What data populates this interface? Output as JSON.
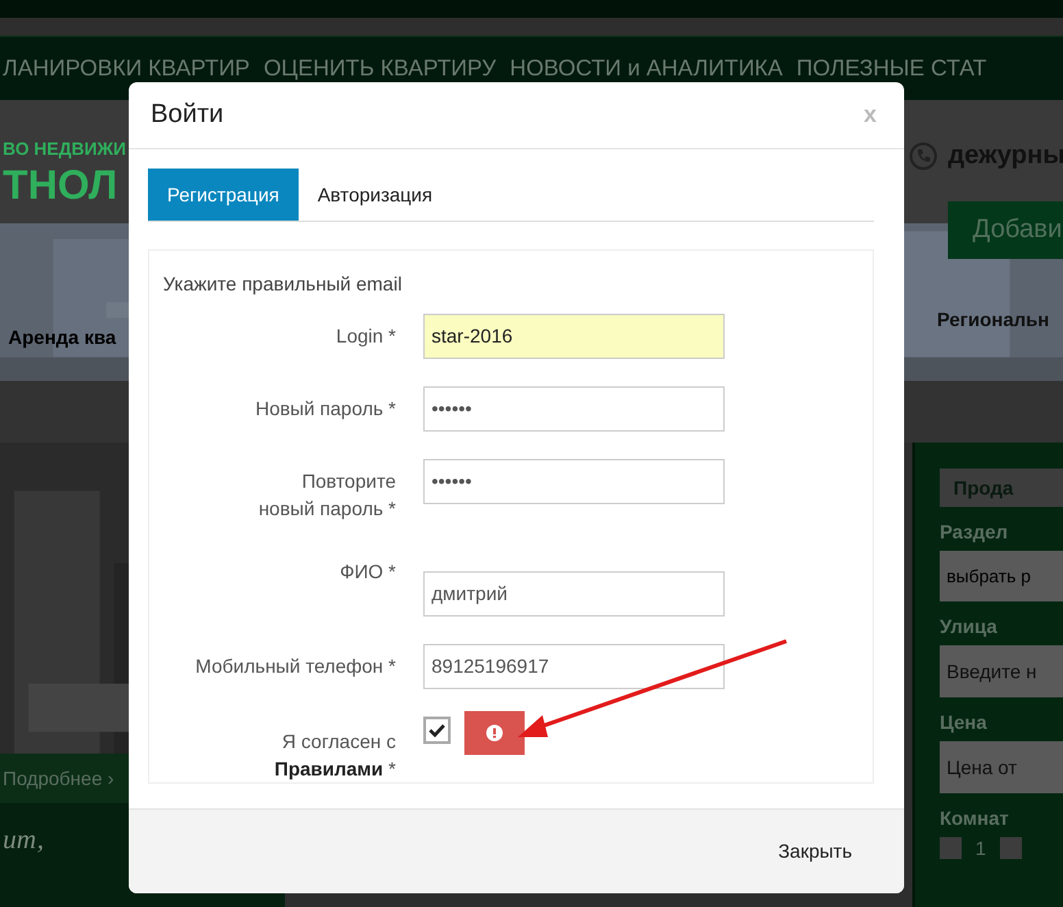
{
  "background": {
    "nav": [
      "ЛАНИРОВКИ КВАРТИР",
      "ОЦЕНИТЬ КВАРТИРУ",
      "НОВОСТИ и АНАЛИТИКА",
      "ПОЛЕЗНЫЕ СТАТ"
    ],
    "header": {
      "tagline": "ВО НЕДВИЖИ",
      "logo": "ТНОЛ",
      "phone": "дежурны",
      "add_button": "Добави",
      "left_caption": "Аренда ква",
      "right_caption": "Региональн"
    },
    "slide": {
      "link": "Подробнее",
      "link_arrow": "›",
      "quote": "ит,"
    },
    "filter": {
      "tab": "Прода",
      "fields": [
        {
          "kind": "select",
          "label": "Раздел",
          "value": "выбрать р"
        },
        {
          "kind": "input",
          "label": "Улица",
          "placeholder": "Введите н"
        },
        {
          "kind": "input",
          "label": "Цена",
          "placeholder": "Цена от"
        },
        {
          "kind": "checks",
          "label": "Комнат",
          "options": [
            {
              "label": "1",
              "checked": false
            },
            {
              "checked": false
            }
          ]
        }
      ]
    }
  },
  "dialog": {
    "title": "Войти",
    "close": "x",
    "tabs": [
      {
        "label": "Регистрация",
        "selected": true
      },
      {
        "label": "Авторизация",
        "selected": false
      }
    ],
    "notice": "Укажите правильный email",
    "fields": [
      {
        "label": "Login *",
        "value": "star-2016",
        "autofilled": true
      },
      {
        "label": "Новый пароль *",
        "value": "••••••",
        "autofilled": false
      },
      {
        "label": "Повторите новый пароль *",
        "value": "••••••",
        "autofilled": false
      },
      {
        "label": "ФИО *",
        "value": "дмитрий",
        "autofilled": false
      },
      {
        "label": "Мобильный телефон *",
        "value": "89125196917",
        "autofilled": false
      }
    ],
    "agreement": {
      "label": "Я согласен с **Правилами** *",
      "checked": true,
      "error": true
    },
    "footer_button": "Закрыть"
  }
}
